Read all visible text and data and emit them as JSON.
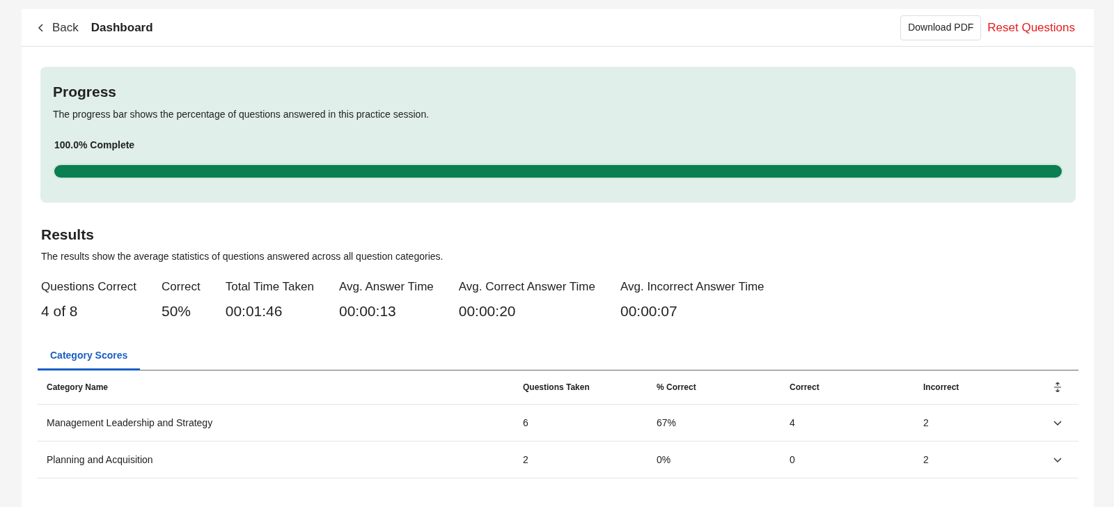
{
  "header": {
    "back_label": "Back",
    "title": "Dashboard",
    "download_button": "Download PDF",
    "reset_button": "Reset Questions"
  },
  "progress": {
    "title": "Progress",
    "description": "The progress bar shows the percentage of questions answered in this practice session.",
    "label": "100.0% Complete",
    "level": 1
  },
  "results": {
    "title": "Results",
    "description": "The results show the average statistics of questions answered across all question categories.",
    "stats": [
      {
        "label": "Questions Correct",
        "value": "4 of 8"
      },
      {
        "label": "Correct",
        "value": "50%"
      },
      {
        "label": "Total Time Taken",
        "value": "00:01:46"
      },
      {
        "label": "Avg. Answer Time",
        "value": "00:00:13"
      },
      {
        "label": "Avg. Correct Answer Time",
        "value": "00:00:20"
      },
      {
        "label": "Avg. Incorrect Answer Time",
        "value": "00:00:07"
      }
    ]
  },
  "tabs": [
    {
      "label": "Category Scores",
      "selected": true
    }
  ],
  "table": {
    "columns": [
      "Category Name",
      "Questions Taken",
      "% Correct",
      "Correct",
      "Incorrect"
    ],
    "rows": [
      {
        "cells": [
          "Management Leadership and Strategy",
          "6",
          "67%",
          "4",
          "2"
        ],
        "expanded": false
      },
      {
        "cells": [
          "Planning and Acquisition",
          "2",
          "0%",
          "0",
          "2"
        ],
        "expanded": false
      }
    ]
  }
}
